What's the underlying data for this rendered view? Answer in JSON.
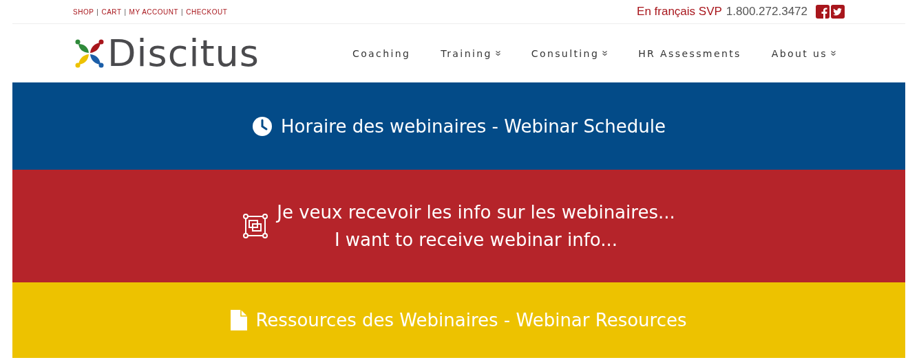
{
  "top_links": [
    "SHOP",
    "CART",
    "MY ACCOUNT",
    "CHECKOUT"
  ],
  "top_link_separator": "|",
  "language_link": "En français SVP",
  "phone": "1.800.272.3472",
  "logo": {
    "text": "Discitus"
  },
  "nav": [
    {
      "label": "Coaching",
      "has_dropdown": false
    },
    {
      "label": "Training",
      "has_dropdown": true
    },
    {
      "label": "Consulting",
      "has_dropdown": true
    },
    {
      "label": "HR Assessments",
      "has_dropdown": false
    },
    {
      "label": "About us",
      "has_dropdown": true
    }
  ],
  "bands": [
    {
      "kind": "clock",
      "color": "#034b88",
      "lines": [
        "Horaire des webinaires - Webinar Schedule"
      ]
    },
    {
      "kind": "frame",
      "color": "#b5242a",
      "lines": [
        "Je veux recevoir les info sur les webinaires...",
        "I want to receive webinar info..."
      ]
    },
    {
      "kind": "document",
      "color": "#edc200",
      "lines": [
        "Ressources des Webinaires - Webinar Resources"
      ]
    }
  ]
}
